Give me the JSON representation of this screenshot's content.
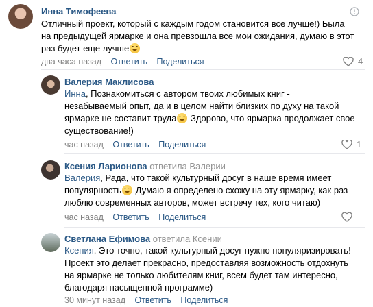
{
  "comments": [
    {
      "author": "Инна Тимофеева",
      "reply_to": "",
      "lines": [
        "Отличный проект, который с каждым годом становится все лучше!) Была",
        "на предыдущей ярмарке и она превзошла все мои ожидания, думаю в этот",
        "раз будет еще лучше"
      ],
      "time": "два часа назад",
      "reply_label": "Ответить",
      "share_label": "Поделиться",
      "likes": "4"
    },
    {
      "author": "Валерия Маклисова",
      "reply_to": "",
      "mention": "Инна",
      "lines": [
        ", Познакомиться с автором твоих любимых книг -",
        "незабываемый опыт, да и в целом найти близких по духу на такой",
        "ярмарке не составит труда",
        " Здорово, что ярмарка продолжает свое",
        "существование!)"
      ],
      "time": "час назад",
      "reply_label": "Ответить",
      "share_label": "Поделиться",
      "likes": "1"
    },
    {
      "author": "Ксения Ларионова",
      "reply_to": "ответила Валерии",
      "mention": "Валерия",
      "lines": [
        ", Рада, что такой культурный досуг в наше время имеет",
        "популярность",
        " Думаю я определено схожу на эту ярмарку, как раз",
        "люблю современных авторов, может встречу тех, кого читаю)"
      ],
      "time": "час назад",
      "reply_label": "Ответить",
      "share_label": "Поделиться",
      "likes": ""
    },
    {
      "author": "Светлана Ефимова",
      "reply_to": "ответила Ксении",
      "mention": "Ксения",
      "lines": [
        ", Это точно, такой культурный досуг нужно популяризировать!",
        "Проект это делает прекрасно, предоставляя возможность отдохнуть",
        "на ярмарке не только любителям книг, всем будет там интересно,",
        "благодаря насыщенной программе)"
      ],
      "time": "30 минут назад",
      "reply_label": "Ответить",
      "share_label": "Поделиться",
      "likes": ""
    }
  ],
  "icons": {
    "like": "heart-icon",
    "report": "warning-icon",
    "emoji": "smile-emoji"
  },
  "colors": {
    "link": "#2a5885",
    "meta": "#828282",
    "separator": "#e7e8ec"
  }
}
